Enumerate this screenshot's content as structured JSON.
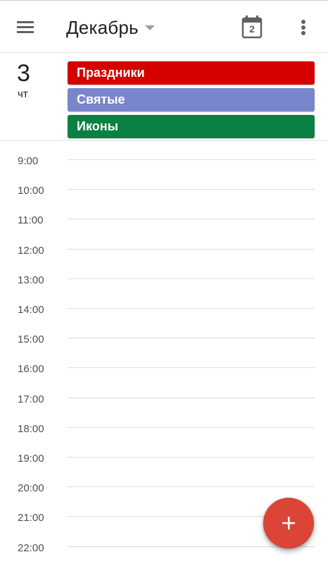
{
  "appbar": {
    "month_title": "Декабрь",
    "today_date": "2",
    "icons": {
      "menu": "menu-icon",
      "dropdown": "arrow-drop-down-icon",
      "today": "calendar-today-icon",
      "more": "more-vertical-icon"
    }
  },
  "day": {
    "number": "3",
    "weekday": "чт"
  },
  "all_day_events": [
    {
      "label": "Праздники",
      "color": "#d50000"
    },
    {
      "label": "Святые",
      "color": "#7986cb"
    },
    {
      "label": "Иконы",
      "color": "#0b8043"
    }
  ],
  "hours": [
    "9:00",
    "10:00",
    "11:00",
    "12:00",
    "13:00",
    "14:00",
    "15:00",
    "16:00",
    "17:00",
    "18:00",
    "19:00",
    "20:00",
    "21:00",
    "22:00"
  ],
  "fab": {
    "icon": "add-icon",
    "color": "#db4437"
  }
}
